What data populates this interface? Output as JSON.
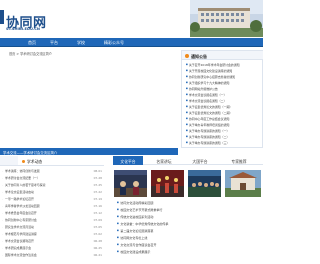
{
  "header": {
    "logo_text": "协同网",
    "logo_sub": "ST.SHINI.EDU.CN"
  },
  "nav": {
    "items": [
      "首页",
      "平台",
      "学校",
      "精彩公众号"
    ]
  },
  "breadcrumb": "首页 > 学术研讨会交流区简介",
  "notice": {
    "title": "通知公告",
    "items": [
      "关于召开2018年学术年会研讨会的通知",
      "关于开展校园文化建设讲座的通知",
      "协同创新研究中心招募志愿者的通知",
      "关于组织学习十九大精神的通知",
      "协同网站升级维护公告",
      "学术交流会议报名通知（一）",
      "学术交流会议报名通知（二）",
      "关于征集优秀论文的通知（一期）",
      "关于征集优秀论文的通知（二期）",
      "协同中心年度工作总结会议通知",
      "关于举办青年教师培训班的通知",
      "关于举办专题讲座的通知（一）",
      "关于举办专题讲座的通知（二）",
      "关于举办专题讲座的通知（三）"
    ]
  },
  "banner": {
    "text": "学术交流——学术研讨会交流区简介"
  },
  "study": {
    "tab_a": "",
    "tab_b": "学术动态",
    "items": [
      {
        "title": "学术讲座：协同创新与发展",
        "date": "08-01"
      },
      {
        "title": "学术研讨会交流纪要（一）",
        "date": "07-28"
      },
      {
        "title": "关于协同育人的若干思考与探索",
        "date": "07-25"
      },
      {
        "title": "学术论文征集活动启动",
        "date": "07-22"
      },
      {
        "title": "一带一路学术论坛召开",
        "date": "07-19"
      },
      {
        "title": "青年学者学术沙龙活动回顾",
        "date": "07-16"
      },
      {
        "title": "学术委员会年度会议召开",
        "date": "07-12"
      },
      {
        "title": "协同创新中心专家研讨会",
        "date": "07-09"
      },
      {
        "title": "研究生学术交流月活动",
        "date": "07-05"
      },
      {
        "title": "学术规范与学风建设讲座",
        "date": "07-02"
      },
      {
        "title": "学术交流会议顺利召开",
        "date": "06-28"
      },
      {
        "title": "学术研究成果展示会",
        "date": "06-25"
      },
      {
        "title": "国际学术交流合作洽谈会",
        "date": "06-21"
      }
    ]
  },
  "culture": {
    "tabs": [
      "文化平台",
      "名家讲坛",
      "大国平台",
      "专家推荐"
    ],
    "items": [
      "协同文化活动周精彩回顾",
      "校园文化艺术节开幕式隆重举行",
      "传统文化进校园系列活动",
      "文化讲堂：中华优秀传统文化的传承",
      "第二届文化论坛圆满落幕",
      "协同网文化专栏上线",
      "文化交流与合作座谈会召开",
      "校园文化建设成果展示"
    ]
  },
  "colors": {
    "nav_blue": "#1f67b8",
    "accent_orange": "#f08a1a"
  }
}
